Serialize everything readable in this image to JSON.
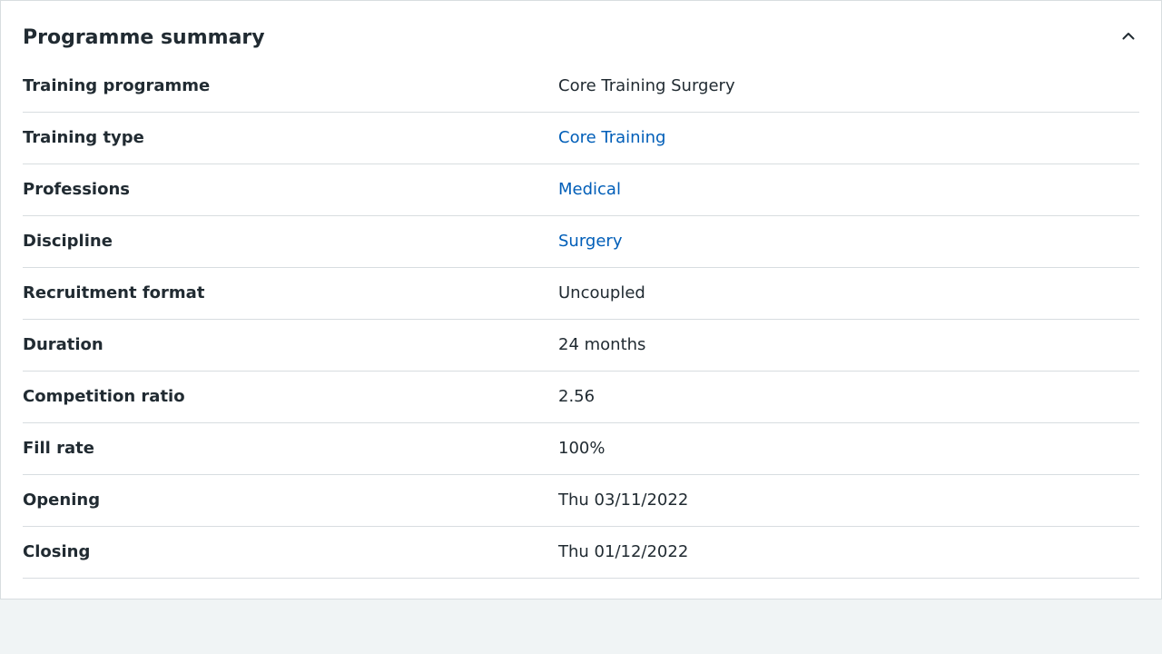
{
  "summary": {
    "title": "Programme summary",
    "toggle_icon": "chevron-up-icon",
    "colors": {
      "link": "#005eb8",
      "text": "#212b32",
      "border": "#d8dde0",
      "page_background": "#f0f4f5"
    },
    "rows": [
      {
        "key": "Training programme",
        "value": "Core Training Surgery",
        "is_link": false
      },
      {
        "key": "Training type",
        "value": "Core Training",
        "is_link": true
      },
      {
        "key": "Professions",
        "value": "Medical",
        "is_link": true
      },
      {
        "key": "Discipline",
        "value": "Surgery",
        "is_link": true
      },
      {
        "key": "Recruitment format",
        "value": "Uncoupled",
        "is_link": false
      },
      {
        "key": "Duration",
        "value": "24 months",
        "is_link": false
      },
      {
        "key": "Competition ratio",
        "value": "2.56",
        "is_link": false
      },
      {
        "key": "Fill rate",
        "value": "100%",
        "is_link": false
      },
      {
        "key": "Opening",
        "value": "Thu 03/11/2022",
        "is_link": false
      },
      {
        "key": "Closing",
        "value": "Thu 01/12/2022",
        "is_link": false
      }
    ]
  }
}
